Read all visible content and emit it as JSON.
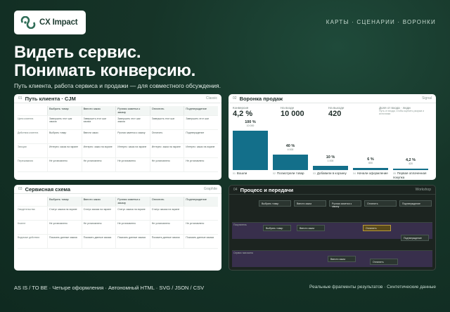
{
  "brand": {
    "name": "CX Impact"
  },
  "nav": {
    "text": "КАРТЫ · СЦЕНАРИИ · ВОРОНКИ"
  },
  "hero": {
    "line1": "Видеть сервис.",
    "line2": "Понимать конверсию."
  },
  "subtitle": "Путь клиента, работа сервиса и продажи — для совместного обсуждения.",
  "cards": {
    "cjm": {
      "num": "01",
      "title": "Путь клиента · CJM",
      "tag": "Classic",
      "columns": [
        "Выбрать товар",
        "Ввести заказ",
        "Ручная заметка к заказу",
        "Оплатить",
        "Подтверждение"
      ],
      "rows": [
        {
          "label": "Цели клиента",
          "cells": [
            "Завершить этот шаг заказа",
            "Завершить этот шаг заказа",
            "Завершить этот шаг заказа",
            "Завершить этот шаг",
            "Завершить этот шаг"
          ]
        },
        {
          "label": "Действия клиента",
          "cells": [
            "Выбрать товар",
            "Ввести заказ",
            "Ручная заметка к заказу",
            "Оплатить",
            "Подтверждение"
          ]
        },
        {
          "label": "Эмоции",
          "cells": [
            "Интерес: заказ на экране",
            "Интерес: заказ на экране",
            "Интерес: заказ на экране",
            "Интерес: заказ на экране",
            "Интерес: заказ на экране"
          ]
        },
        {
          "label": "Переживания",
          "cells": [
            "Не установлено",
            "Не установлено",
            "Не установлено",
            "Не установлено",
            "Не установлено"
          ]
        }
      ]
    },
    "funnel": {
      "num": "02",
      "title": "Воронка продаж",
      "tag": "Signal",
      "stats": [
        {
          "label": "Конверсия",
          "value": "4,2 %",
          "sub": ""
        },
        {
          "label": "На входе",
          "value": "10 000",
          "sub": ""
        },
        {
          "label": "На выходе",
          "value": "420",
          "sub": ""
        },
        {
          "label": "Доля от входа · люди",
          "value": "",
          "sub": "Путь от входа, чтобы оценить разрыв и источники"
        }
      ],
      "stages": [
        {
          "num": "01",
          "label": "Вошли",
          "pct": "100 %",
          "count": "10 000",
          "share": 1.0
        },
        {
          "num": "02",
          "label": "Посмотрели товар",
          "pct": "40 %",
          "count": "4 000",
          "share": 0.4
        },
        {
          "num": "03",
          "label": "Добавили в корзину",
          "pct": "10 %",
          "count": "1 000",
          "share": 0.1
        },
        {
          "num": "04",
          "label": "Начали оформление",
          "pct": "6 %",
          "count": "600",
          "share": 0.06
        },
        {
          "num": "05",
          "label": "Первая оплаченная покупка",
          "pct": "4,2 %",
          "count": "420",
          "share": 0.042
        }
      ]
    },
    "service": {
      "num": "03",
      "title": "Сервисная схема",
      "tag": "Graphite",
      "columns": [
        "Выбрать товар",
        "Ввести заказ",
        "Ручная заметка к заказу",
        "Оплатить",
        "Подтверждение"
      ],
      "rows": [
        {
          "label": "Свидетельства",
          "cells": [
            "Статус заказа на экране",
            "Статус заказа на экране",
            "Статус заказа на экране",
            "Статус заказа на экране",
            ""
          ]
        },
        {
          "label": "Клиент",
          "cells": [
            "Не установлено",
            "Не установлено",
            "Не установлено",
            "Не установлено",
            "Не установлено"
          ]
        },
        {
          "label": "Видимые действия",
          "cells": [
            "Показать данные заказа",
            "Показать данные заказа",
            "Показать данные заказа",
            "Показать данные заказа",
            "Показать данные заказа"
          ]
        }
      ]
    },
    "process": {
      "num": "04",
      "title": "Процесс и передачи",
      "tag": "Workshop",
      "columns": [
        "Выбрать товар",
        "Ввести заказ",
        "Ручная заметка к заказу",
        "Оплатить",
        "Подтверждение"
      ],
      "lanes": [
        "Покупатель",
        "Сервис магазина"
      ],
      "nodes": [
        "Выбрать товар",
        "Ввести заказ",
        "Оплатить",
        "Подтверждение",
        "Ввести заказ",
        "Оплатить"
      ]
    }
  },
  "footer": {
    "left": "AS IS / TO BE · Четыре оформления · Автономный HTML · SVG / JSON / CSV",
    "right": "Реальные фрагменты результатов · Синтетические данные"
  },
  "colors": {
    "accent": "#136f8a",
    "bg": "#163428",
    "highlight": "#b89a3c"
  }
}
